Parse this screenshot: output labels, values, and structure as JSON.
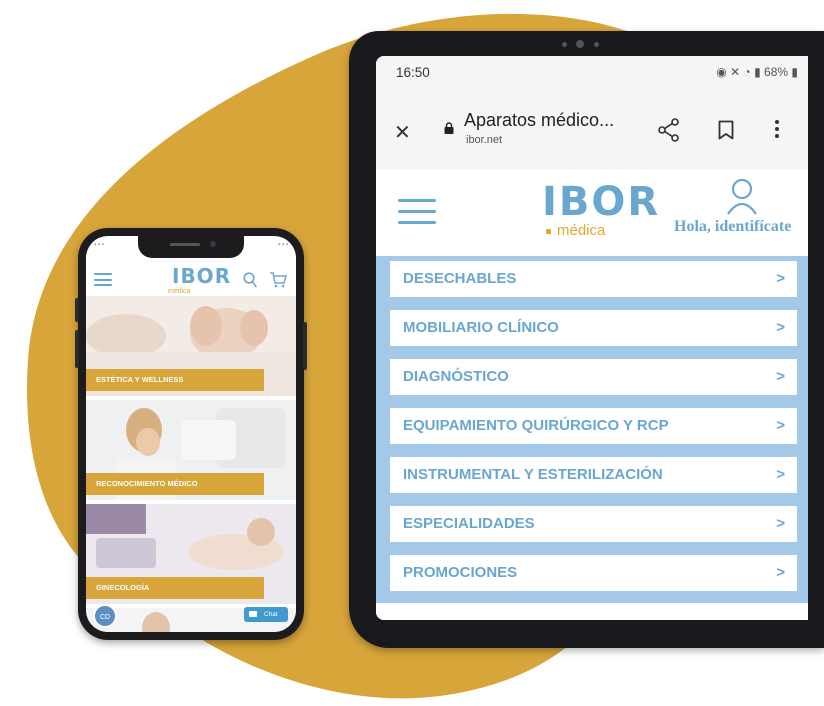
{
  "colors": {
    "blob": "#d7a53a",
    "brand_blue": "#6aa7cf",
    "brand_gold": "#e0a92d",
    "menu_bg": "#a3c8e8"
  },
  "phone": {
    "logo": "IBOR",
    "logo_sub": "médica",
    "icons": [
      "menu-icon",
      "search-icon",
      "cart-icon"
    ],
    "tiles": [
      {
        "label": "ESTÉTICA Y WELLNESS"
      },
      {
        "label": "RECONOCIMIENTO MÉDICO"
      },
      {
        "label": "GINECOLOGÍA"
      }
    ],
    "cd_badge": "CD",
    "chat_label": "Chat"
  },
  "tablet": {
    "status": {
      "time": "16:50",
      "battery": "68%"
    },
    "urlbar": {
      "title": "Aparatos médico...",
      "host": "ibor.net"
    },
    "header": {
      "logo": "IBOR",
      "logo_sub": "médica",
      "user_label": "Hola, identifícate"
    },
    "menu": [
      {
        "label": "DESECHABLES",
        "arrow": ">"
      },
      {
        "label": "MOBILIARIO CLÍNICO",
        "arrow": ">"
      },
      {
        "label": "DIAGNÓSTICO",
        "arrow": ">"
      },
      {
        "label": "EQUIPAMIENTO QUIRÚRGICO Y RCP",
        "arrow": ">"
      },
      {
        "label": "INSTRUMENTAL Y ESTERILIZACIÓN",
        "arrow": ">"
      },
      {
        "label": "ESPECIALIDADES",
        "arrow": ">"
      },
      {
        "label": "PROMOCIONES",
        "arrow": ">"
      }
    ]
  }
}
